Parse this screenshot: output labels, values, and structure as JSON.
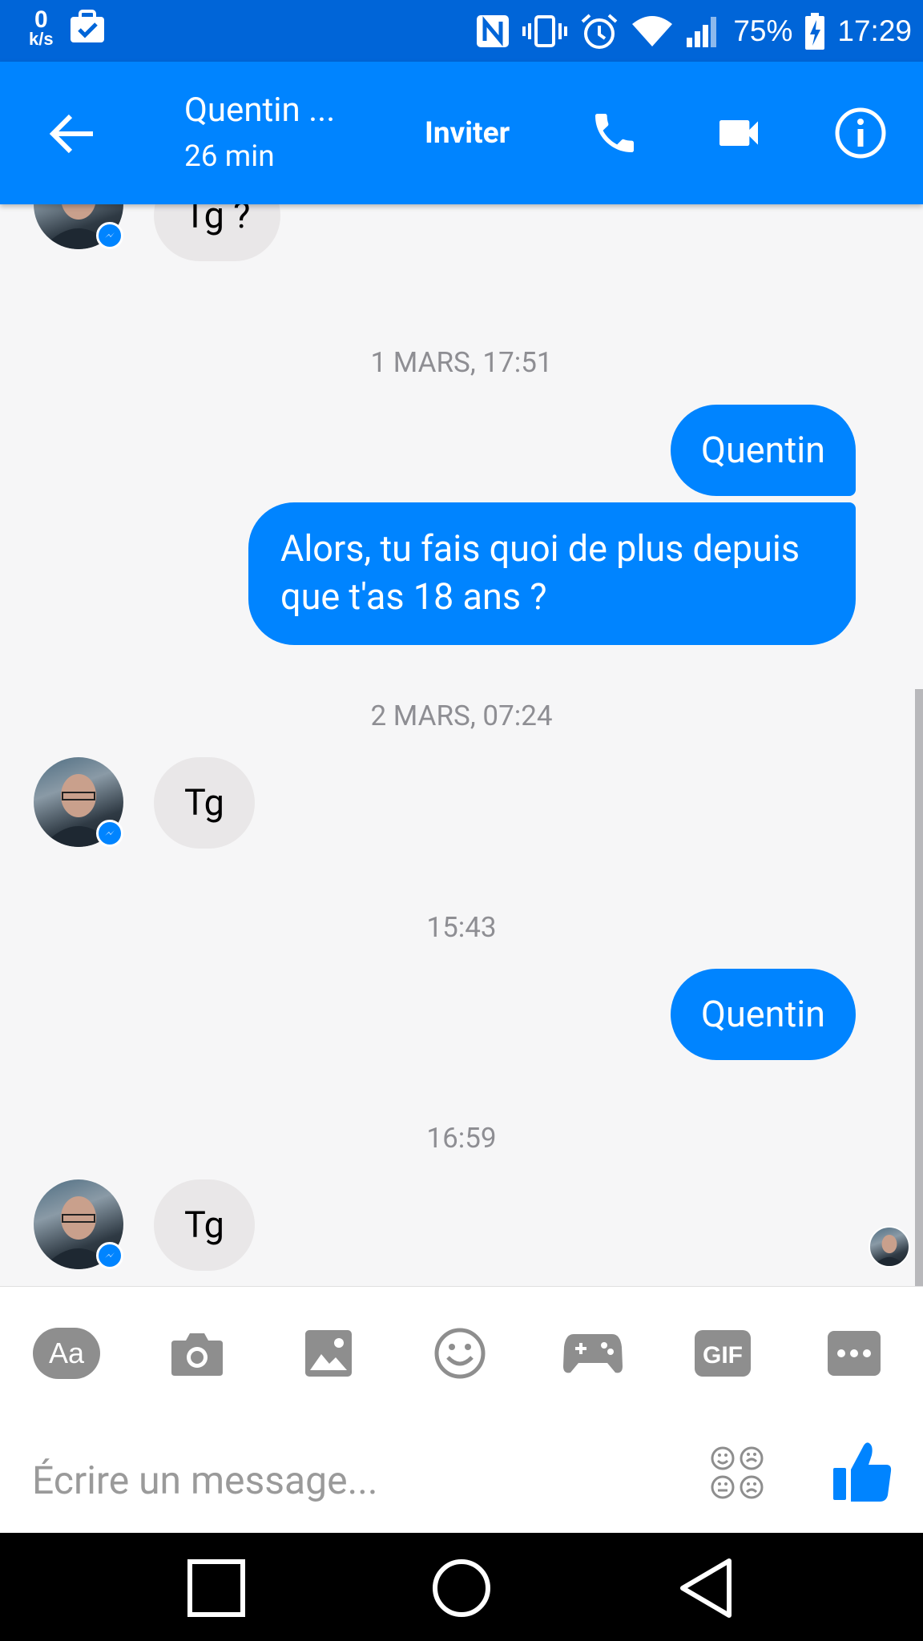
{
  "status_bar": {
    "net_speed_value": "0",
    "net_speed_unit": "k/s",
    "battery": "75%",
    "time": "17:29"
  },
  "header": {
    "title": "Quentin ...",
    "subtitle": "26 min",
    "invite_label": "Inviter"
  },
  "messages": [
    {
      "type": "in",
      "text": "Tg ?"
    },
    {
      "type": "timestamp",
      "text": "1 MARS, 17:51"
    },
    {
      "type": "out",
      "text": "Quentin"
    },
    {
      "type": "out",
      "text": "Alors, tu fais quoi de plus depuis que t'as 18 ans ?"
    },
    {
      "type": "timestamp",
      "text": "2 MARS, 07:24"
    },
    {
      "type": "in",
      "text": "Tg"
    },
    {
      "type": "timestamp",
      "text": "15:43"
    },
    {
      "type": "out",
      "text": "Quentin"
    },
    {
      "type": "timestamp",
      "text": "16:59"
    },
    {
      "type": "in",
      "text": "Tg"
    }
  ],
  "composer": {
    "aa_label": "Aa",
    "gif_label": "GIF",
    "placeholder": "Écrire un message..."
  },
  "colors": {
    "accent": "#0084ff",
    "status_bar": "#0065d8",
    "incoming_bubble": "#e9e7e8",
    "tool_gray": "#8e8e8e"
  }
}
